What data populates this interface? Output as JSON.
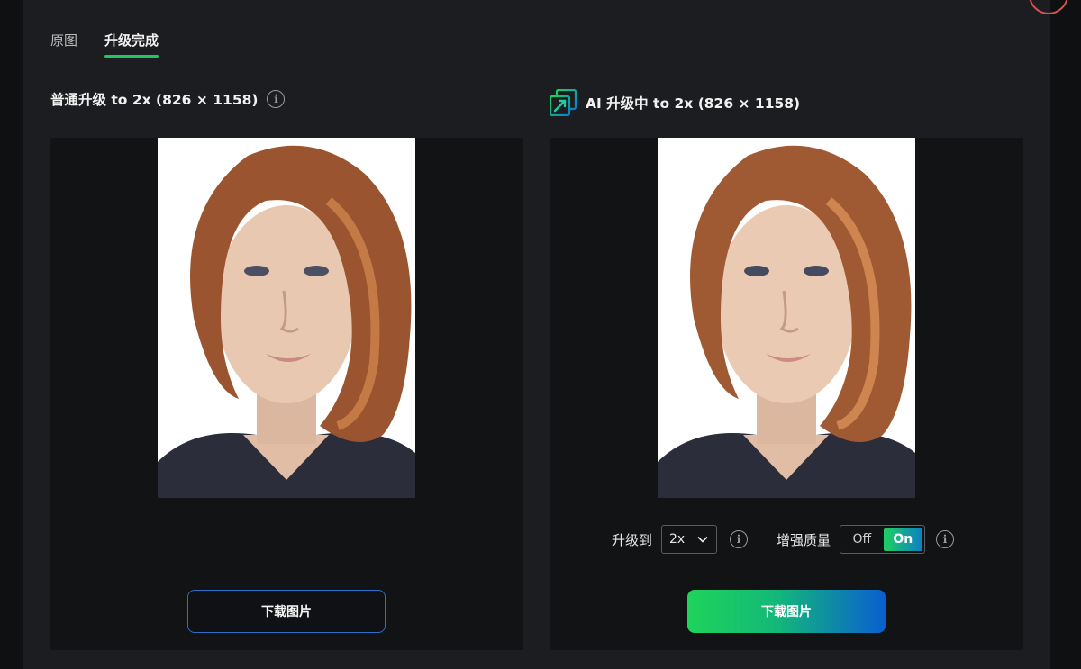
{
  "tabs": [
    {
      "label": "原图",
      "active": false
    },
    {
      "label": "升级完成",
      "active": true
    }
  ],
  "left": {
    "title": "普通升级 to 2x (826 × 1158)",
    "download_label": "下载图片"
  },
  "right": {
    "title": "AI 升级中 to 2x (826 × 1158)",
    "upscale_label": "升级到",
    "upscale_value": "2x",
    "enhance_label": "增强质量",
    "toggle_off": "Off",
    "toggle_on": "On",
    "toggle_state": "On",
    "download_label": "下载图片"
  },
  "icons": {
    "info": "info-icon",
    "ai_badge": "ai-upscale-icon",
    "chevron": "chevron-down-icon"
  },
  "colors": {
    "accent_green": "#22c55e",
    "gradient_start": "#1fd35a",
    "gradient_end": "#0a5fd0",
    "outline_blue": "#2d6ec9"
  }
}
